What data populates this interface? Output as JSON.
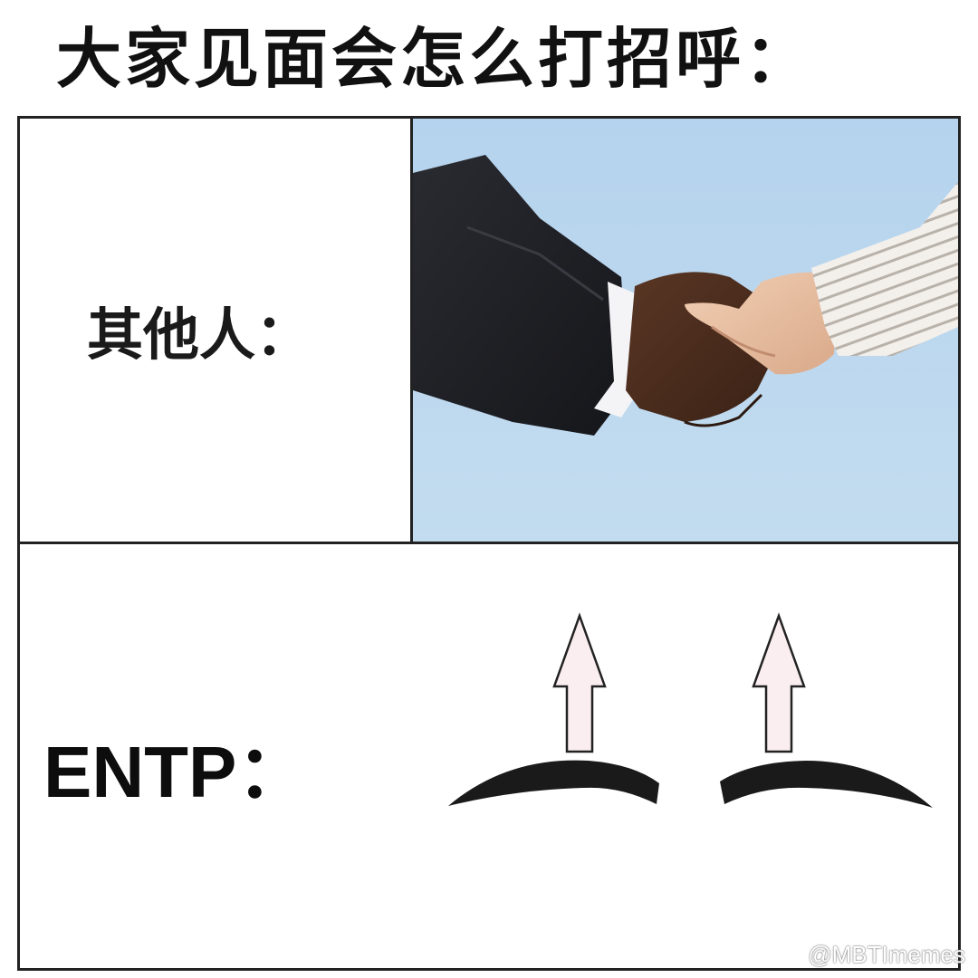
{
  "title": "大家见面会怎么打招呼：",
  "panels": {
    "others_label": "其他人：",
    "entp_label": "ENTP："
  },
  "watermark": {
    "icon": "weibo-icon",
    "text": "@MBTImemes"
  },
  "colors": {
    "sky": "#b9d6ee",
    "suit": "#1c1d22",
    "arrow_fill": "#fbeef0",
    "brow": "#1a1a1a"
  }
}
